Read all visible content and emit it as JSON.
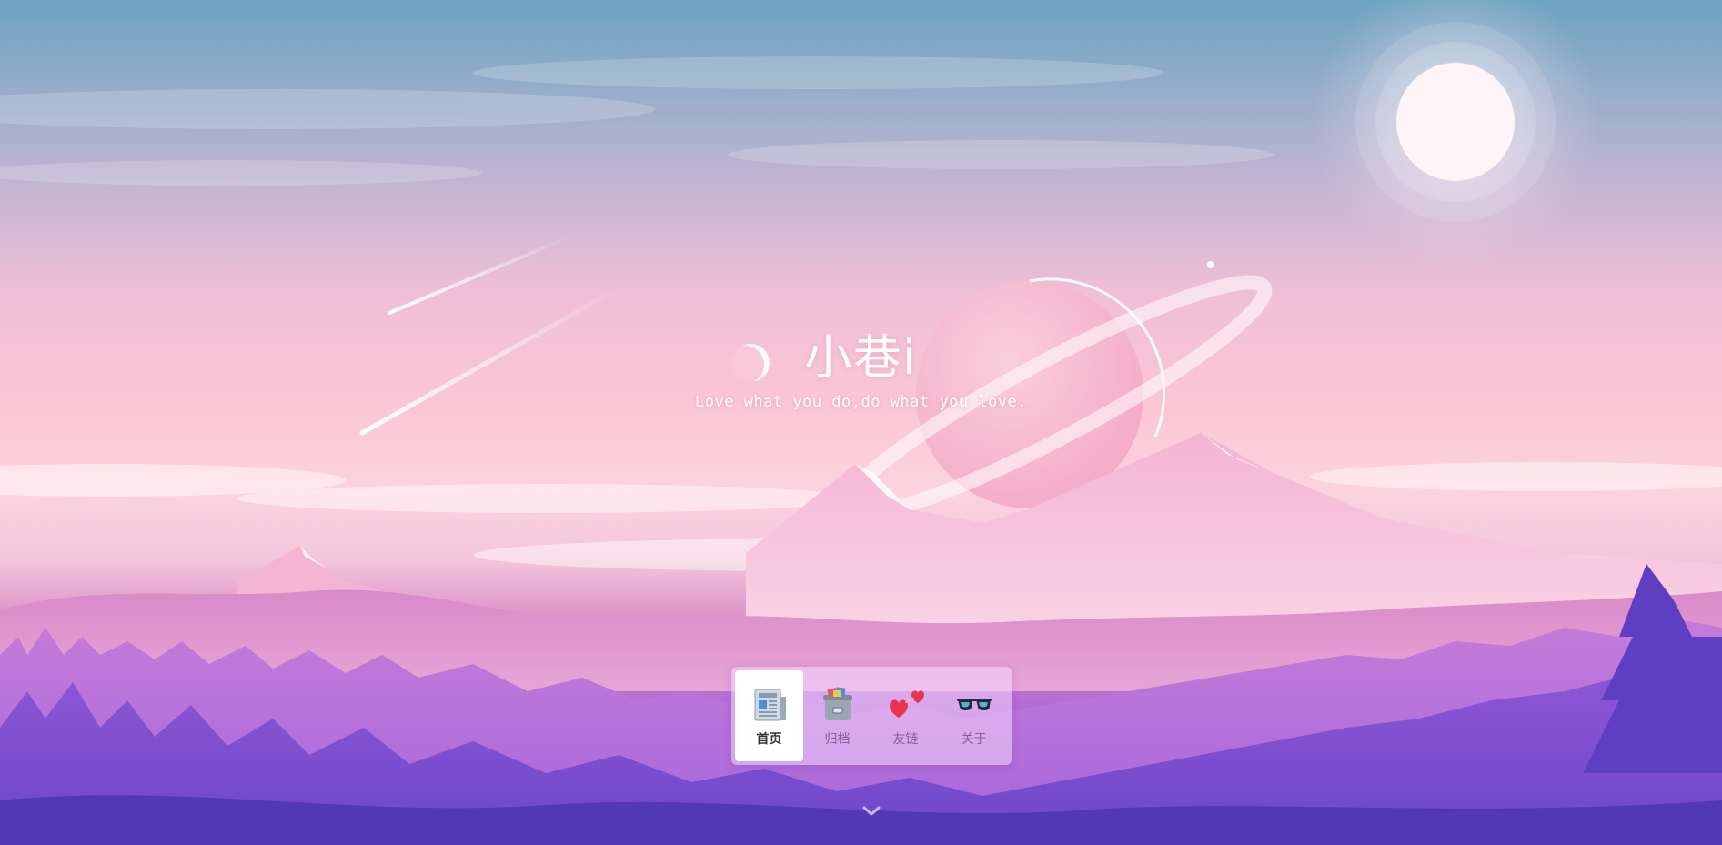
{
  "site": {
    "title": "小巷i",
    "subtitle": "Love what you do,do what you love."
  },
  "nav": {
    "items": [
      {
        "label": "首页",
        "icon": "newspaper-icon",
        "active": true
      },
      {
        "label": "归档",
        "icon": "archive-box-icon",
        "active": false
      },
      {
        "label": "友链",
        "icon": "two-hearts-icon",
        "active": false
      },
      {
        "label": "关于",
        "icon": "sunglasses-icon",
        "active": false
      }
    ]
  },
  "scroll_hint": {
    "icon": "chevron-down-icon"
  },
  "colors": {
    "sky_top": "#6ea3c2",
    "sky_pink": "#fbc6d6",
    "forest_purple": "#7a4bd6",
    "nav_bg": "#f5d7ff",
    "active_bg": "#ffffff"
  }
}
